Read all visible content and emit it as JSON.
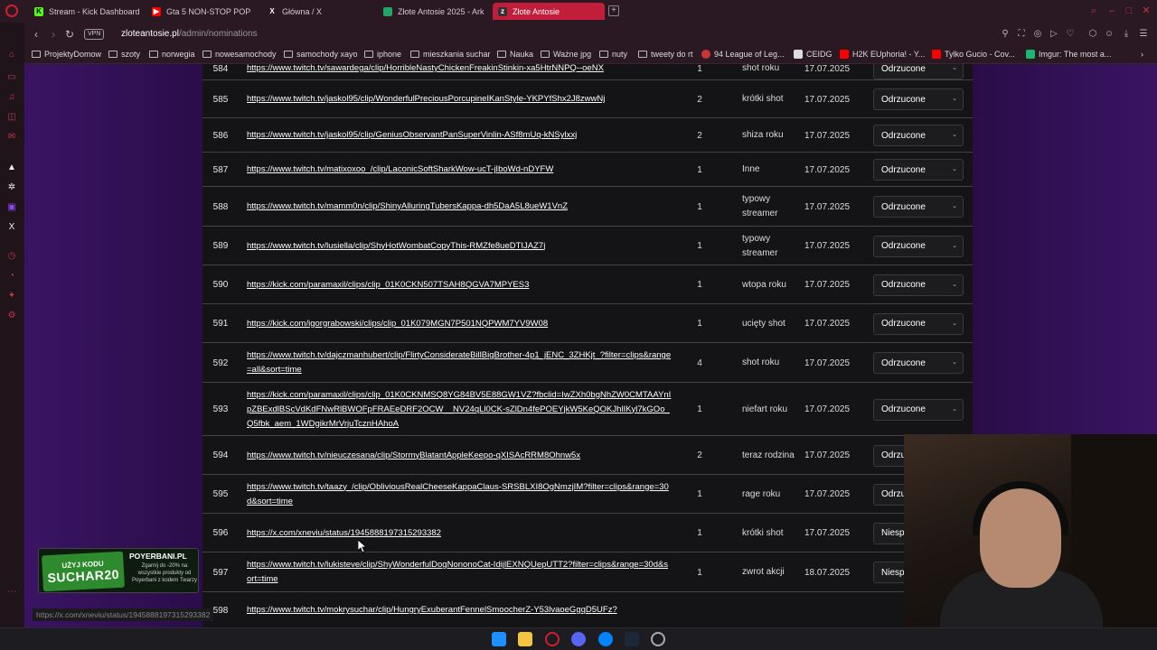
{
  "tabs": [
    {
      "label": "Stream - Kick Dashboard",
      "icon": "kick-icon",
      "color": "#53fc18"
    },
    {
      "label": "Gta 5 NON-STOP POP ra",
      "icon": "youtube-icon",
      "color": "#ff0000"
    },
    {
      "label": "Główna / X",
      "icon": "x-icon",
      "color": "#ffffff"
    },
    {
      "label": "Złote Antosie 2025 - Ark",
      "icon": "sheets-icon",
      "color": "#21a464"
    },
    {
      "label": "Złote Antosie",
      "icon": "site-icon",
      "color": "#333333",
      "active": true
    }
  ],
  "address": {
    "vpn": "VPN",
    "host": "zloteantosie.pl",
    "path": "/admin/nominations"
  },
  "bookmarks": [
    {
      "label": "ProjektyDomow",
      "icon": "folder-icon"
    },
    {
      "label": "szoty",
      "icon": "folder-icon"
    },
    {
      "label": "norwegia",
      "icon": "folder-icon"
    },
    {
      "label": "nowesamochody",
      "icon": "folder-icon"
    },
    {
      "label": "samochody xayo",
      "icon": "folder-icon"
    },
    {
      "label": "iphone",
      "icon": "folder-icon"
    },
    {
      "label": "mieszkania suchar",
      "icon": "folder-icon"
    },
    {
      "label": "Nauka",
      "icon": "folder-icon"
    },
    {
      "label": "Ważne jpg",
      "icon": "folder-icon"
    },
    {
      "label": "nuty",
      "icon": "folder-icon"
    },
    {
      "label": "tweety do rt",
      "icon": "folder-icon"
    },
    {
      "label": "94 League of Leg...",
      "icon": "lol-icon"
    },
    {
      "label": "CEIDG",
      "icon": "ceidg-icon"
    },
    {
      "label": "H2K EUphoria! - Y...",
      "icon": "youtube-icon"
    },
    {
      "label": "Tylko Gucio - Cov...",
      "icon": "youtube-icon"
    },
    {
      "label": "Imgur: The most a...",
      "icon": "imgur-icon"
    }
  ],
  "nominations": [
    {
      "id": "584",
      "url": "https://www.twitch.tv/sawardega/clip/HorribleNastyChickenFreakinStinkin-xa5HtrNNPQ--oeNX",
      "count": "1",
      "category": "shot roku",
      "date": "17.07.2025",
      "status": "Odrzucone"
    },
    {
      "id": "585",
      "url": "https://www.twitch.tv/jaskol95/clip/WonderfulPreciousPorcupineIKanStyle-YKPYfShx2J8zwwNj",
      "count": "2",
      "category": "krótki shot",
      "date": "17.07.2025",
      "status": "Odrzucone"
    },
    {
      "id": "586",
      "url": "https://www.twitch.tv/jaskol95/clip/GeniusObservantPanSuperVinlin-ASf8mUq-kNSylxxj",
      "count": "2",
      "category": "shiza roku",
      "date": "17.07.2025",
      "status": "Odrzucone"
    },
    {
      "id": "587",
      "url": "https://www.twitch.tv/matixoxoo_/clip/LaconicSoftSharkWow-ucT-jIboWd-nDYFW",
      "count": "1",
      "category": "Inne",
      "date": "17.07.2025",
      "status": "Odrzucone"
    },
    {
      "id": "588",
      "url": "https://www.twitch.tv/mamm0n/clip/ShinyAlluringTubersKappa-dh5DaA5L8ueW1VnZ",
      "count": "1",
      "category": "typowy streamer",
      "date": "17.07.2025",
      "status": "Odrzucone"
    },
    {
      "id": "589",
      "url": "https://www.twitch.tv/lusiella/clip/ShyHotWombatCopyThis-RMZfe8ueDTIJAZ7j",
      "count": "1",
      "category": "typowy streamer",
      "date": "17.07.2025",
      "status": "Odrzucone"
    },
    {
      "id": "590",
      "url": "https://kick.com/paramaxil/clips/clip_01K0CKN507TSAH8QGVA7MPYES3",
      "count": "1",
      "category": "wtopa roku",
      "date": "17.07.2025",
      "status": "Odrzucone"
    },
    {
      "id": "591",
      "url": "https://kick.com/igorgrabowski/clips/clip_01K079MGN7P501NQPWM7YV9W08",
      "count": "1",
      "category": "ucięty shot",
      "date": "17.07.2025",
      "status": "Odrzucone"
    },
    {
      "id": "592",
      "url": "https://www.twitch.tv/dajczmanhubert/clip/FlirtyConsiderateBillBigBrother-4p1_jENC_3ZHKjt_?filter=clips&range=all&sort=time",
      "count": "4",
      "category": "shot roku",
      "date": "17.07.2025",
      "status": "Odrzucone"
    },
    {
      "id": "593",
      "url": "https://kick.com/paramaxil/clips/clip_01K0CKNMSQ8YG84BV5E88GW1VZ?fbclid=IwZXh0bgNhZW0CMTAAYnIpZBExdlBScVdKdFNwRlBWOFpFRAEeDRF2OCW__NV24qLl0CK-sZlDn4fePOEYjkW5KeQOKJhlIKyl7kGOo_Q5fbk_aem_1WDgikrMrVrjuTcznHAhoA",
      "count": "1",
      "category": "niefart roku",
      "date": "17.07.2025",
      "status": "Odrzucone"
    },
    {
      "id": "594",
      "url": "https://www.twitch.tv/nieuczesana/clip/StormyBlatantAppleKeepo-qXISAcRRM8Ohnw5x",
      "count": "2",
      "category": "teraz rodzina",
      "date": "17.07.2025",
      "status": "Odrzu"
    },
    {
      "id": "595",
      "url": "https://www.twitch.tv/taazy_/clip/ObliviousRealCheeseKappaClaus-SRSBLXI8OgNmzjIM?filter=clips&range=30d&sort=time",
      "count": "1",
      "category": "rage roku",
      "date": "17.07.2025",
      "status": "Odrzu"
    },
    {
      "id": "596",
      "url": "https://x.com/xneviu/status/1945888197315293382",
      "count": "1",
      "category": "krótki shot",
      "date": "17.07.2025",
      "status": "Niesp"
    },
    {
      "id": "597",
      "url": "https://www.twitch.tv/lukisteve/clip/ShyWonderfulDogNononoCat-IdijlEXNQUepUTT2?filter=clips&range=30d&sort=time",
      "count": "1",
      "category": "zwrot akcji",
      "date": "18.07.2025",
      "status": "Niesp"
    },
    {
      "id": "598",
      "url": "https://www.twitch.tv/mokrysuchar/clip/HungryExuberantFennelSmoocherZ-Y53lvaoeGgqD5UFz?",
      "count": "",
      "category": "",
      "date": "",
      "status": ""
    }
  ],
  "promo": {
    "top": "UŻYJ KODU",
    "code": "SUCHAR20",
    "brand": "POYERBANI.PL",
    "desc": "Zgarnij do -20% na wszystkie produkty od Poyerbani z kodem Twarzy"
  },
  "status_url": "https://x.com/xneviu/status/1945888197315293382"
}
